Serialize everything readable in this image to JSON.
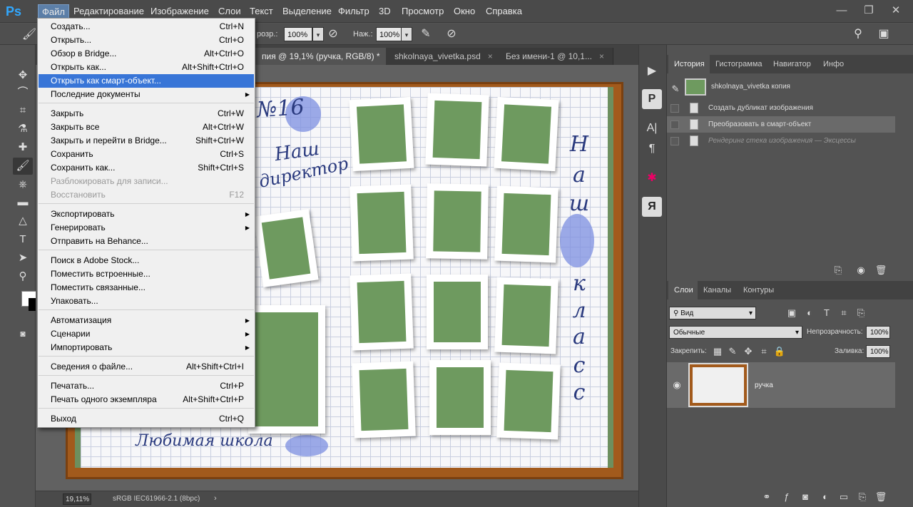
{
  "app": {
    "logo": "Ps"
  },
  "menubar": {
    "items": [
      "Файл",
      "Редактирование",
      "Изображение",
      "Слои",
      "Текст",
      "Выделение",
      "Фильтр",
      "3D",
      "Просмотр",
      "Окно",
      "Справка"
    ],
    "window_controls": {
      "minimize": "—",
      "restore": "❐",
      "close": "✕"
    }
  },
  "options": {
    "opacity_label": "розр.:",
    "opacity_value": "100%",
    "pressure_label": "Наж.:",
    "pressure_value": "100%"
  },
  "tabs": [
    {
      "label": "пия @ 19,1% (ручка, RGB/8) *",
      "close": "×"
    },
    {
      "label": "shkolnaya_vivetka.psd",
      "close": "×"
    },
    {
      "label": "Без имени-1 @ 10,1...",
      "close": "×"
    }
  ],
  "artwork": {
    "number": "№16",
    "caption_top": "Наш",
    "caption_sub": "директор",
    "footer": "Любимая школа",
    "vertical_title": [
      "Н",
      "а",
      "ш",
      "к",
      "л",
      "а",
      "с",
      "с"
    ]
  },
  "status": {
    "zoom": "19,11%",
    "profile": "sRGB IEC61966-2.1 (8bpc)",
    "arrow": "›"
  },
  "file_menu": {
    "groups": [
      [
        {
          "label": "Создать...",
          "shortcut": "Ctrl+N"
        },
        {
          "label": "Открыть...",
          "shortcut": "Ctrl+O"
        },
        {
          "label": "Обзор в Bridge...",
          "shortcut": "Alt+Ctrl+O"
        },
        {
          "label": "Открыть как...",
          "shortcut": "Alt+Shift+Ctrl+O"
        },
        {
          "label": "Открыть как смарт-объект...",
          "shortcut": "",
          "highlight": true
        },
        {
          "label": "Последние документы",
          "shortcut": "",
          "submenu": true
        }
      ],
      [
        {
          "label": "Закрыть",
          "shortcut": "Ctrl+W"
        },
        {
          "label": "Закрыть все",
          "shortcut": "Alt+Ctrl+W"
        },
        {
          "label": "Закрыть и перейти в Bridge...",
          "shortcut": "Shift+Ctrl+W"
        },
        {
          "label": "Сохранить",
          "shortcut": "Ctrl+S"
        },
        {
          "label": "Сохранить как...",
          "shortcut": "Shift+Ctrl+S"
        },
        {
          "label": "Разблокировать для записи...",
          "shortcut": "",
          "disabled": true
        },
        {
          "label": "Восстановить",
          "shortcut": "F12",
          "disabled": true
        }
      ],
      [
        {
          "label": "Экспортировать",
          "shortcut": "",
          "submenu": true
        },
        {
          "label": "Генерировать",
          "shortcut": "",
          "submenu": true
        },
        {
          "label": "Отправить на Behance...",
          "shortcut": ""
        }
      ],
      [
        {
          "label": "Поиск в Adobe Stock...",
          "shortcut": ""
        },
        {
          "label": "Поместить встроенные...",
          "shortcut": ""
        },
        {
          "label": "Поместить связанные...",
          "shortcut": ""
        },
        {
          "label": "Упаковать...",
          "shortcut": ""
        }
      ],
      [
        {
          "label": "Автоматизация",
          "shortcut": "",
          "submenu": true
        },
        {
          "label": "Сценарии",
          "shortcut": "",
          "submenu": true
        },
        {
          "label": "Импортировать",
          "shortcut": "",
          "submenu": true
        }
      ],
      [
        {
          "label": "Сведения о файле...",
          "shortcut": "Alt+Shift+Ctrl+I"
        }
      ],
      [
        {
          "label": "Печатать...",
          "shortcut": "Ctrl+P"
        },
        {
          "label": "Печать одного экземпляра",
          "shortcut": "Alt+Shift+Ctrl+P"
        }
      ],
      [
        {
          "label": "Выход",
          "shortcut": "Ctrl+Q"
        }
      ]
    ]
  },
  "history_panel": {
    "tabs": [
      "История",
      "Гистограмма",
      "Навигатор",
      "Инфо"
    ],
    "snapshot": "shkolnaya_vivetka копия",
    "items": [
      {
        "label": "Создать дубликат изображения"
      },
      {
        "label": "Преобразовать в смарт-объект",
        "selected": true
      },
      {
        "label": "Рендеринг стека изображения — Эксцессы",
        "dim": true
      }
    ]
  },
  "layers_panel": {
    "tabs": [
      "Слои",
      "Каналы",
      "Контуры"
    ],
    "filter_kind": "Вид",
    "blend_mode": "Обычные",
    "opacity_label": "Непрозрачность:",
    "opacity_value": "100%",
    "lock_label": "Закрепить:",
    "fill_label": "Заливка:",
    "fill_value": "100%",
    "layers": [
      {
        "name": "ручка"
      }
    ]
  },
  "colors": {
    "menu_highlight": "#3875d7",
    "menubar_active": "#5c7fa8",
    "frame_wood": "#a25a1c",
    "photo_green": "#6e9a5f"
  }
}
